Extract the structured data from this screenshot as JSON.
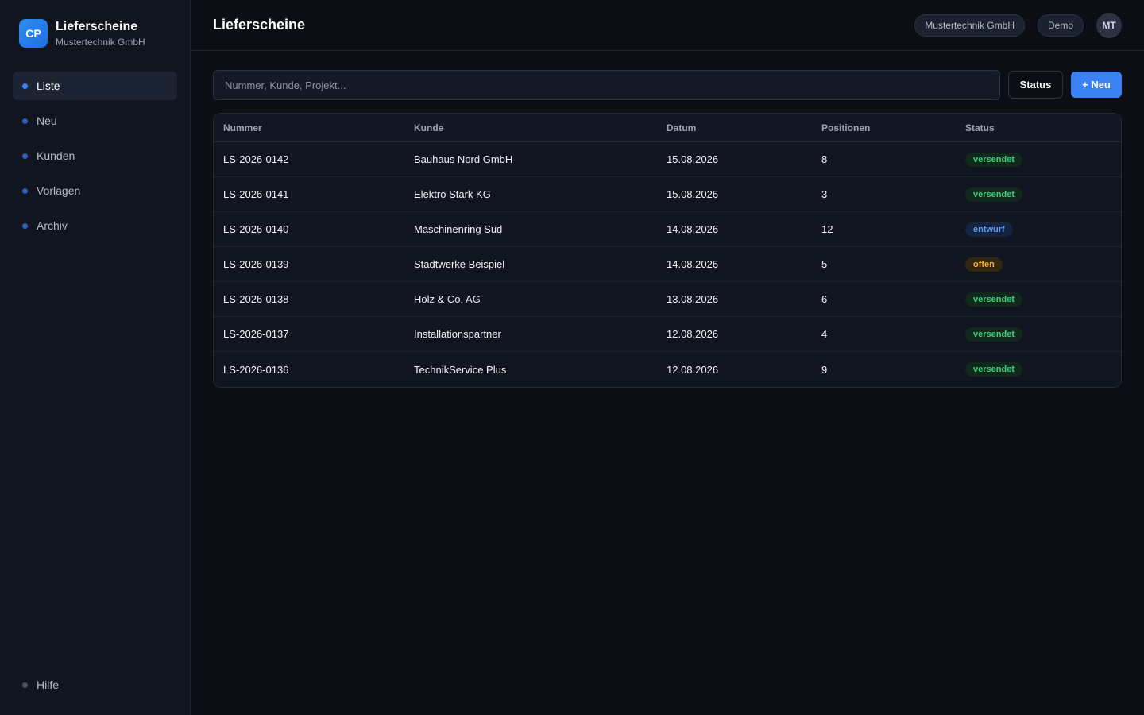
{
  "brand": {
    "logo": "CP",
    "title": "Lieferscheine",
    "subtitle": "Mustertechnik GmbH"
  },
  "sidebar": {
    "items": [
      {
        "label": "Liste",
        "active": true
      },
      {
        "label": "Neu"
      },
      {
        "label": "Kunden"
      },
      {
        "label": "Vorlagen"
      },
      {
        "label": "Archiv"
      }
    ],
    "bottom": {
      "label": "Hilfe"
    }
  },
  "header": {
    "title": "Lieferscheine",
    "company": "Mustertechnik GmbH",
    "mode": "Demo",
    "avatar": "MT"
  },
  "toolbar": {
    "search_placeholder": "Nummer, Kunde, Projekt...",
    "search_value": "",
    "status_label": "Status",
    "new_label": "+ Neu"
  },
  "table": {
    "columns": [
      "Nummer",
      "Kunde",
      "Datum",
      "Positionen",
      "Status"
    ],
    "rows": [
      {
        "nummer": "LS-2026-0142",
        "kunde": "Bauhaus Nord GmbH",
        "datum": "15.08.2026",
        "positionen": "8",
        "status": "versendet"
      },
      {
        "nummer": "LS-2026-0141",
        "kunde": "Elektro Stark KG",
        "datum": "15.08.2026",
        "positionen": "3",
        "status": "versendet"
      },
      {
        "nummer": "LS-2026-0140",
        "kunde": "Maschinenring Süd",
        "datum": "14.08.2026",
        "positionen": "12",
        "status": "entwurf"
      },
      {
        "nummer": "LS-2026-0139",
        "kunde": "Stadtwerke Beispiel",
        "datum": "14.08.2026",
        "positionen": "5",
        "status": "offen"
      },
      {
        "nummer": "LS-2026-0138",
        "kunde": "Holz & Co. AG",
        "datum": "13.08.2026",
        "positionen": "6",
        "status": "versendet"
      },
      {
        "nummer": "LS-2026-0137",
        "kunde": "Installationspartner",
        "datum": "12.08.2026",
        "positionen": "4",
        "status": "versendet"
      },
      {
        "nummer": "LS-2026-0136",
        "kunde": "TechnikService Plus",
        "datum": "12.08.2026",
        "positionen": "9",
        "status": "versendet"
      }
    ]
  },
  "colors": {
    "accent": "#3b82f6",
    "status_versendet": "#34d27a",
    "status_entwurf": "#5b9cf5",
    "status_offen": "#f5b22d"
  }
}
